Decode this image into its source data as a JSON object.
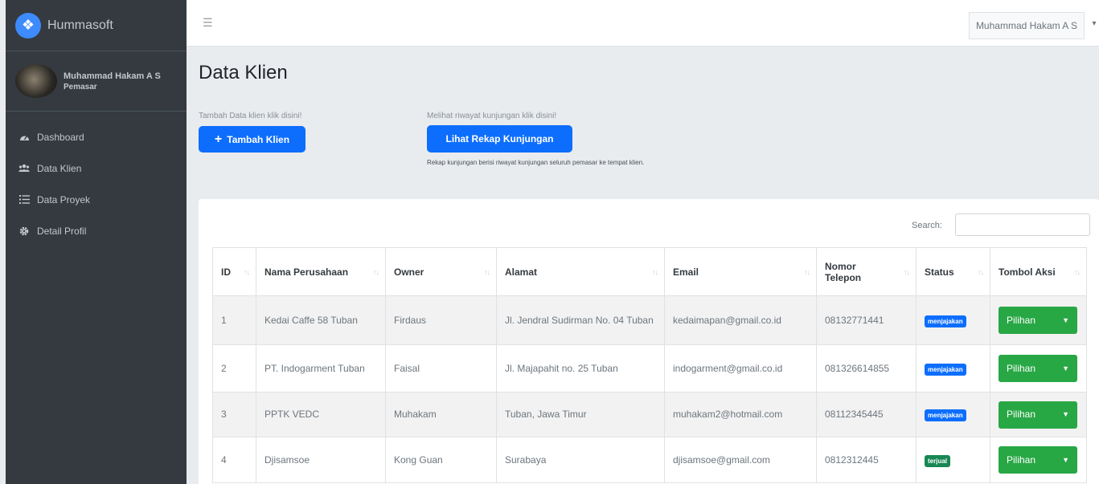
{
  "app": {
    "brand": "Hummasoft"
  },
  "user": {
    "name": "Muhammad Hakam A S",
    "role": "Pemasar"
  },
  "sidebar": {
    "items": [
      {
        "label": "Dashboard",
        "icon": "tachometer-icon"
      },
      {
        "label": "Data Klien",
        "icon": "users-icon"
      },
      {
        "label": "Data Proyek",
        "icon": "list-icon"
      },
      {
        "label": "Detail Profil",
        "icon": "gear-icon"
      }
    ]
  },
  "topbar": {
    "user_label": "Muhammad Hakam A S"
  },
  "main": {
    "title": "Data Klien",
    "add_hint": "Tambah Data klien klik disini!",
    "add_button": "Tambah Klien",
    "history_hint": "Melihat riwayat kunjungan klik disini!",
    "history_button": "Lihat Rekap Kunjungan",
    "history_note": "Rekap kunjungan berisi riwayat kunjungan seluruh pemasar ke tempat klien.",
    "search_label": "Search:",
    "search_value": ""
  },
  "table": {
    "headers": [
      "ID",
      "Nama Perusahaan",
      "Owner",
      "Alamat",
      "Email",
      "Nomor Telepon",
      "Status",
      "Tombol Aksi"
    ],
    "rows": [
      {
        "id": "1",
        "company": "Kedai Caffe 58 Tuban",
        "owner": "Firdaus",
        "address": "Jl. Jendral Sudirman No. 04 Tuban",
        "email": "kedaimapan@gmail.co.id",
        "phone": "08132771441",
        "status": "menjajakan",
        "status_color": "#0d6efd",
        "action": "Pilihan"
      },
      {
        "id": "2",
        "company": "PT. Indogarment Tuban",
        "owner": "Faisal",
        "address": "Jl. Majapahit no. 25 Tuban",
        "email": "indogarment@gmail.co.id",
        "phone": "081326614855",
        "status": "menjajakan",
        "status_color": "#0d6efd",
        "action": "Pilihan"
      },
      {
        "id": "3",
        "company": "PPTK VEDC",
        "owner": "Muhakam",
        "address": "Tuban, Jawa Timur",
        "email": "muhakam2@hotmail.com",
        "phone": "08112345445",
        "status": "menjajakan",
        "status_color": "#0d6efd",
        "action": "Pilihan"
      },
      {
        "id": "4",
        "company": "Djisamsoe",
        "owner": "Kong Guan",
        "address": "Surabaya",
        "email": "djisamsoe@gmail.com",
        "phone": "0812312445",
        "status": "terjual",
        "status_color": "#198754",
        "action": "Pilihan"
      }
    ]
  }
}
